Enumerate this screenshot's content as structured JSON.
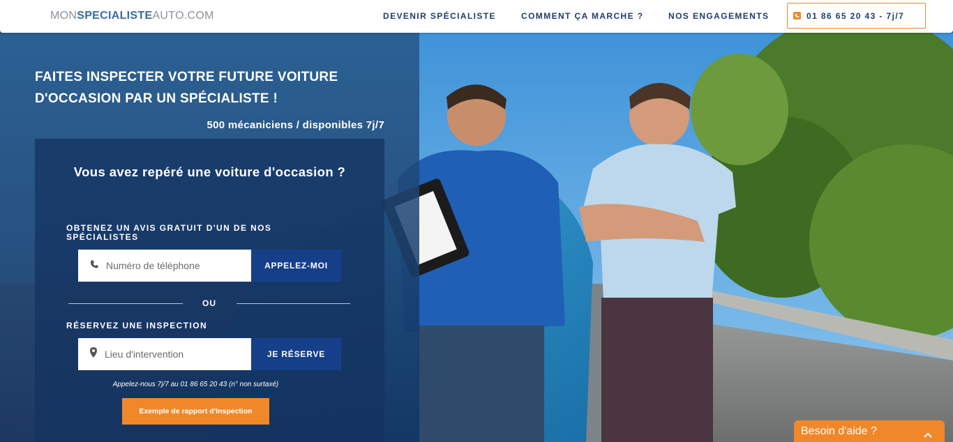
{
  "header": {
    "logo": {
      "part1": "MON",
      "part2": "SPECIALISTE",
      "part3": "AUTO.COM"
    },
    "nav": [
      {
        "label": "DEVENIR SPÉCIALISTE"
      },
      {
        "label": "COMMENT ÇA MARCHE ?"
      },
      {
        "label": "NOS ENGAGEMENTS"
      }
    ],
    "phone": {
      "label": "01 86 65 20 43 - 7j/7",
      "icon": "phone-icon"
    }
  },
  "hero": {
    "title": "FAITES INSPECTER VOTRE FUTURE VOITURE D'OCCASION PAR UN SPÉCIALISTE !",
    "subtitle": "500 mécaniciens / disponibles 7j/7"
  },
  "form": {
    "title": "Vous avez repéré une voiture d'occasion ?",
    "section1_label": "OBTENEZ UN AVIS GRATUIT D'UN DE NOS SPÉCIALISTES",
    "phone_input": {
      "placeholder": "Numéro de téléphone",
      "value": "",
      "icon": "phone-icon"
    },
    "call_button": "APPELEZ-MOI",
    "or_text": "OU",
    "section2_label": "RÉSERVEZ UNE INSPECTION",
    "location_input": {
      "placeholder": "Lieu d'intervention",
      "value": "",
      "icon": "map-pin-icon"
    },
    "reserve_button": "JE RÉSERVE",
    "call_note": "Appelez-nous 7j/7 au 01 86 65 20 43 (n° non surtaxé)",
    "report_button": "Exemple de rapport d'Inspection"
  },
  "help_widget": {
    "label": "Besoin d'aide ?",
    "icon": "chevron-up-icon"
  },
  "colors": {
    "accent_orange": "#f0882a",
    "nav_blue": "#1e3d6b",
    "button_blue": "#163f8a",
    "panel_blue": "#14325f"
  }
}
